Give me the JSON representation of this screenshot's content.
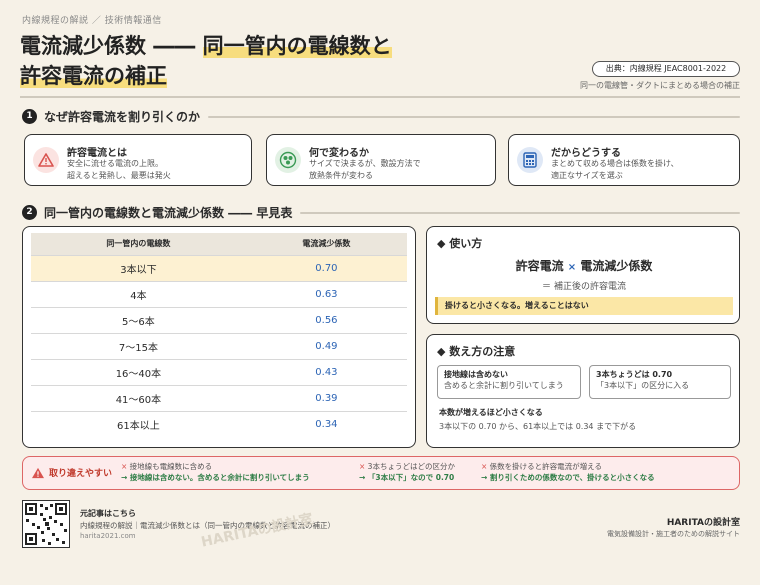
{
  "header": {
    "category": "内線規程の解説 ／ 技術情報通信",
    "title_part1": "電流減少係数 ―― ",
    "title_highlight": "同一管内の電線数と",
    "title_line2": "許容電流の補正",
    "source": "出典：内線規程 JEAC8001-2022",
    "subtitle": "同一の電線管・ダクトにまとめる場合の補正"
  },
  "section1": {
    "num": "1",
    "title": "なぜ許容電流を割り引くのか",
    "cards": [
      {
        "title": "許容電流とは",
        "line1": "安全に流せる電流の上限。",
        "line2": "超えると発熱し、最悪は発火"
      },
      {
        "title": "何で変わるか",
        "line1": "サイズで決まるが、敷設方法で",
        "line2": "放熱条件が変わる"
      },
      {
        "title": "だからどうする",
        "line1": "まとめて収める場合は係数を掛け、",
        "line2": "適正なサイズを選ぶ"
      }
    ]
  },
  "section2": {
    "num": "2",
    "title": "同一管内の電線数と電流減少係数 ―― 早見表"
  },
  "table": {
    "col1": "同一管内の電線数",
    "col2": "電流減少係数",
    "rows": [
      {
        "count": "3本以下",
        "factor": "0.70"
      },
      {
        "count": "4本",
        "factor": "0.63"
      },
      {
        "count": "5～6本",
        "factor": "0.56"
      },
      {
        "count": "7～15本",
        "factor": "0.49"
      },
      {
        "count": "16～40本",
        "factor": "0.43"
      },
      {
        "count": "41～60本",
        "factor": "0.39"
      },
      {
        "count": "61本以上",
        "factor": "0.34"
      }
    ]
  },
  "usage": {
    "title": "使い方",
    "term1": "許容電流",
    "times": "×",
    "term2": "電流減少係数",
    "eq": "＝",
    "result": "補正後の許容電流",
    "note": "掛けると小さくなる。増えることはない"
  },
  "count_notes": {
    "title": "数え方の注意",
    "box1_title": "接地線は含めない",
    "box1_text": "含めると余計に割り引いてしまう",
    "box2_title": "3本ちょうどは 0.70",
    "box2_text": "「3本以下」の区分に入る",
    "line_title": "本数が増えるほど小さくなる",
    "line_text": "3本以下の 0.70 から、61本以上では 0.34 まで下がる"
  },
  "mistakes": {
    "label": "取り違えやすい",
    "items": [
      {
        "wrong": "接地線も電線数に含める",
        "right": "接地線は含めない。含めると余計に割り引いてしまう"
      },
      {
        "wrong": "3本ちょうどはどの区分か",
        "right": "「3本以下」なので 0.70"
      },
      {
        "wrong": "係数を掛けると許容電流が増える",
        "right": "割り引くための係数なので、掛けると小さくなる"
      }
    ]
  },
  "footer": {
    "qr_title": "元記事はこちら",
    "qr_desc": "内線規程の解説｜電流減少係数とは（同一管内の電線数と許容電流の補正）",
    "url": "harita2021.com",
    "brand": "HARITAの設計室",
    "brand_sub": "電気設備設計・施工者のための解説サイト",
    "watermark": "HARITAの設計室"
  },
  "colors": {
    "accent": "#2c64b5",
    "highlight": "#f7dd7e",
    "warn": "#d9534f",
    "green": "#3a9a55"
  }
}
